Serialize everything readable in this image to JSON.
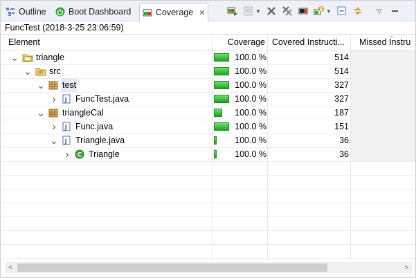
{
  "tabs": [
    {
      "label": "Outline",
      "icon": "outline-icon"
    },
    {
      "label": "Boot Dashboard",
      "icon": "boot-dashboard-icon"
    },
    {
      "label": "Coverage",
      "icon": "coverage-icon"
    }
  ],
  "close_glyph": "✕",
  "session_title": "FuncTest (2018-3-25 23:06:59)",
  "columns": [
    "Element",
    "Coverage",
    "Covered Instructi...",
    "Missed Instru"
  ],
  "rows": [
    {
      "name": "triangle",
      "icon": "project-folder-icon",
      "coverage": "100.0 %",
      "coverage_fraction": 1.0,
      "covered": "514",
      "expanded": true
    },
    {
      "name": "src",
      "icon": "source-folder-icon",
      "coverage": "100.0 %",
      "coverage_fraction": 1.0,
      "covered": "514",
      "expanded": true
    },
    {
      "name": "test",
      "icon": "package-icon",
      "coverage": "100.0 %",
      "coverage_fraction": 1.0,
      "covered": "327",
      "expanded": true
    },
    {
      "name": "FuncTest.java",
      "icon": "java-file-icon",
      "coverage": "100.0 %",
      "coverage_fraction": 1.0,
      "covered": "327",
      "expanded": false
    },
    {
      "name": "triangleCal",
      "icon": "package-icon",
      "coverage": "100.0 %",
      "coverage_fraction": 0.55,
      "covered": "187",
      "expanded": true
    },
    {
      "name": "Func.java",
      "icon": "java-file-icon",
      "coverage": "100.0 %",
      "coverage_fraction": 1.0,
      "covered": "151",
      "expanded": false
    },
    {
      "name": "Triangle.java",
      "icon": "java-file-icon",
      "coverage": "100.0 %",
      "coverage_fraction": 0.2,
      "covered": "36",
      "expanded": true
    },
    {
      "name": "Triangle",
      "icon": "class-icon",
      "coverage": "100.0 %",
      "coverage_fraction": 0.2,
      "covered": "36",
      "expanded": false
    }
  ],
  "colors": {
    "bar_fill": "#2fb52f",
    "selection": "#e5eaf3",
    "tabbar": "#eef1f6"
  }
}
